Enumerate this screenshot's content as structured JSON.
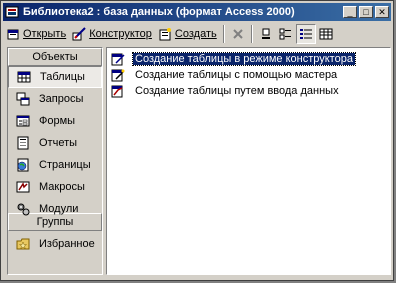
{
  "window": {
    "title": "Библиотека2 : база данных (формат Access 2000)"
  },
  "title_buttons": [
    {
      "name": "minimize-button",
      "glyph": "_"
    },
    {
      "name": "maximize-button",
      "glyph": "□"
    },
    {
      "name": "close-button",
      "glyph": "✕"
    }
  ],
  "toolbar": {
    "open_label": "Открыть",
    "design_label": "Конструктор",
    "create_label": "Создать"
  },
  "left": {
    "objects_header": "Объекты",
    "objects": [
      {
        "label": "Таблицы",
        "icon": "table-icon",
        "selected": true
      },
      {
        "label": "Запросы",
        "icon": "query-icon"
      },
      {
        "label": "Формы",
        "icon": "form-icon"
      },
      {
        "label": "Отчеты",
        "icon": "report-icon"
      },
      {
        "label": "Страницы",
        "icon": "page-icon"
      },
      {
        "label": "Макросы",
        "icon": "macro-icon"
      },
      {
        "label": "Модули",
        "icon": "module-icon"
      }
    ],
    "groups_header": "Группы",
    "groups": [
      {
        "label": "Избранное",
        "icon": "favorites-icon"
      }
    ]
  },
  "list": {
    "items": [
      {
        "label": "Создание таблицы в режиме конструктора",
        "selected": true
      },
      {
        "label": "Создание таблицы с помощью мастера"
      },
      {
        "label": "Создание таблицы путем ввода данных"
      }
    ]
  },
  "colors": {
    "title_bar": "#0a246a",
    "selection": "#0a246a",
    "face": "#d4d0c8"
  }
}
